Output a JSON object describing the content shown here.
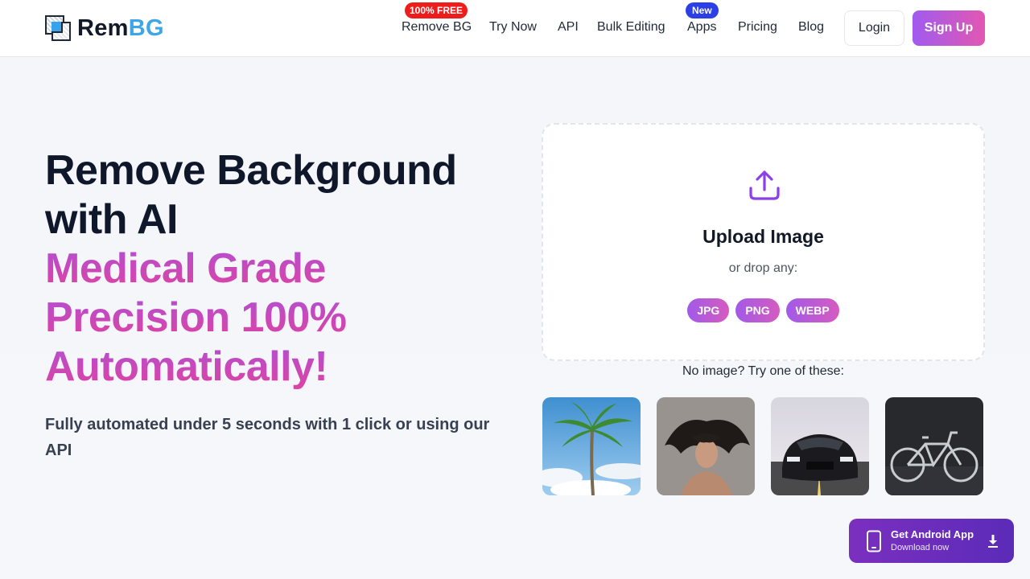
{
  "brand": {
    "name_part1": "Rem",
    "name_part2": "BG"
  },
  "nav": {
    "items": [
      {
        "label": "Remove BG"
      },
      {
        "label": "Try Now"
      },
      {
        "label": "API"
      },
      {
        "label": "Bulk Editing"
      },
      {
        "label": "Apps"
      },
      {
        "label": "Pricing"
      },
      {
        "label": "Blog"
      }
    ],
    "badge_free": "100% FREE",
    "badge_new": "New",
    "login_label": "Login",
    "signup_label": "Sign Up"
  },
  "hero": {
    "title_line1": "Remove Background",
    "title_line2": "with AI",
    "title_line3": "Medical Grade",
    "title_line4": "Precision 100%",
    "title_line5": "Automatically!",
    "subtitle": "Fully automated under 5 seconds with 1 click or using our API"
  },
  "upload": {
    "title": "Upload Image",
    "subtitle": "or drop any:",
    "formats": [
      "JPG",
      "PNG",
      "WEBP"
    ]
  },
  "samples": {
    "label": "No image? Try one of these:",
    "items": [
      "palm-tree",
      "woman-hair",
      "sports-car",
      "bicycle"
    ]
  },
  "android_cta": {
    "title": "Get Android App",
    "subtitle": "Download now"
  },
  "colors": {
    "accent_purple": "#a05bef",
    "accent_pink": "#e257b2",
    "logo_blue": "#3ea6e6",
    "badge_red": "#ef1c1c",
    "badge_blue": "#2c3fe6"
  },
  "icons": [
    "upload-icon",
    "phone-icon",
    "download-icon"
  ]
}
